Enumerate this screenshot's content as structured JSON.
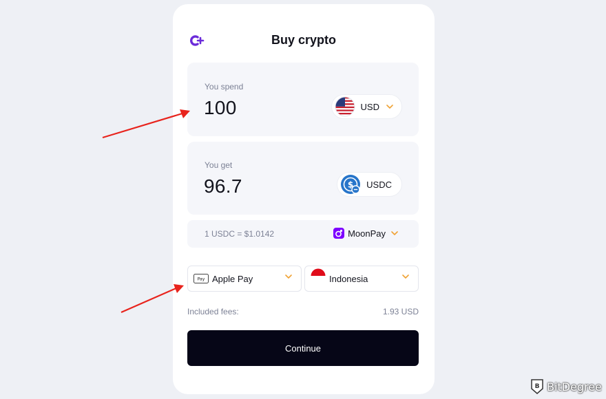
{
  "header": {
    "title": "Buy crypto",
    "logo_icon": "cplus-logo-icon",
    "accent": "#6b2bd9"
  },
  "spend": {
    "label": "You spend",
    "amount": "100",
    "currency": "USD",
    "currency_icon": "us-flag-icon"
  },
  "get": {
    "label": "You get",
    "amount": "96.7",
    "currency": "USDC",
    "currency_icon": "usdc-icon"
  },
  "rate": {
    "text": "1 USDC = $1.0142",
    "provider": "MoonPay",
    "provider_icon": "moonpay-icon"
  },
  "payment": {
    "method": "Apple Pay",
    "method_icon": "apple-pay-icon"
  },
  "country": {
    "name": "Indonesia",
    "flag_icon": "indonesia-flag-icon"
  },
  "fees": {
    "label": "Included fees:",
    "value": "1.93 USD"
  },
  "actions": {
    "continue_label": "Continue"
  },
  "colors": {
    "chevron": "#f0a234",
    "annotation_arrow": "#e8231c",
    "button_bg": "#060617"
  },
  "watermark": {
    "text": "BitDegree"
  }
}
